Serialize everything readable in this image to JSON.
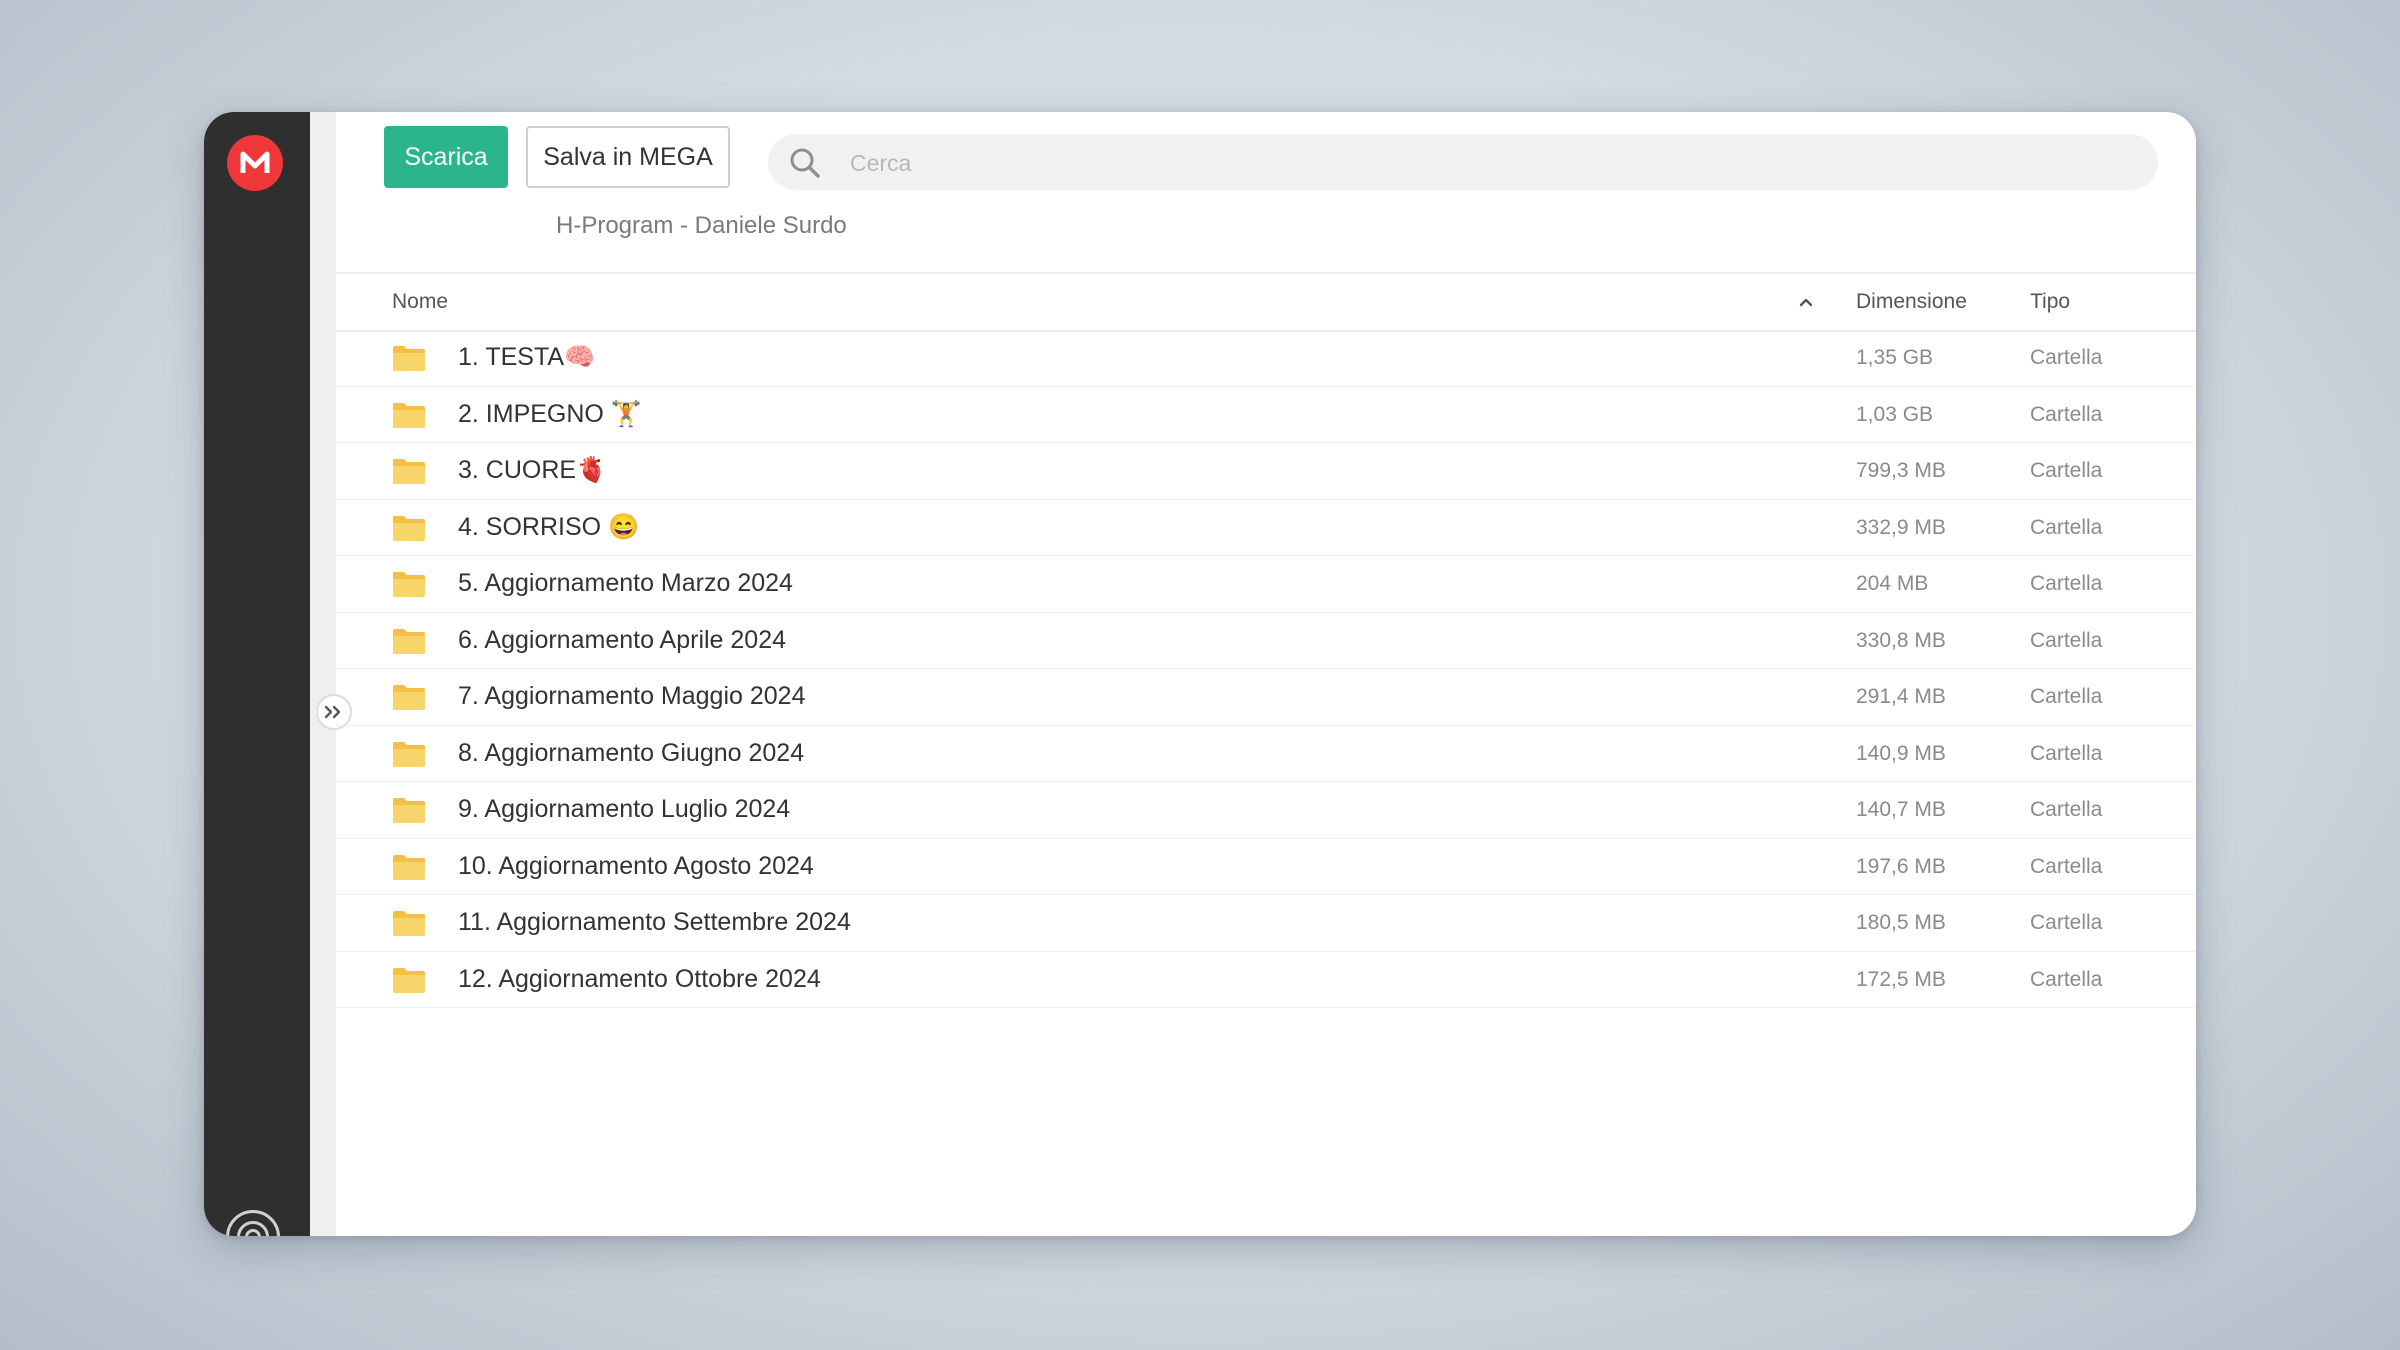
{
  "colors": {
    "accent": "#2bb58a",
    "brand": "#f0373a",
    "sidebar": "#2f2f2f",
    "folder": "#f5c84b"
  },
  "sidebar": {
    "logo_icon": "mega-logo-icon",
    "logo_letter": "M",
    "bottom_icon": "transfers-icon"
  },
  "toolbar": {
    "download_label": "Scarica",
    "save_label": "Salva in MEGA"
  },
  "search": {
    "placeholder": "Cerca",
    "icon": "search-icon"
  },
  "breadcrumb": "H-Program - Daniele Surdo",
  "table": {
    "columns": {
      "name": "Nome",
      "size": "Dimensione",
      "type": "Tipo"
    },
    "sort_icon": "chevron-up-icon",
    "rows": [
      {
        "name": "1. TESTA🧠",
        "size": "1,35 GB",
        "type": "Cartella"
      },
      {
        "name": "2. IMPEGNO 🏋",
        "size": "1,03 GB",
        "type": "Cartella"
      },
      {
        "name": "3. CUORE🫀",
        "size": "799,3 MB",
        "type": "Cartella"
      },
      {
        "name": "4. SORRISO 😄",
        "size": "332,9 MB",
        "type": "Cartella"
      },
      {
        "name": "5. Aggiornamento Marzo 2024",
        "size": "204 MB",
        "type": "Cartella"
      },
      {
        "name": "6. Aggiornamento Aprile 2024",
        "size": "330,8 MB",
        "type": "Cartella"
      },
      {
        "name": "7. Aggiornamento Maggio 2024",
        "size": "291,4 MB",
        "type": "Cartella"
      },
      {
        "name": "8. Aggiornamento Giugno 2024",
        "size": "140,9 MB",
        "type": "Cartella"
      },
      {
        "name": "9. Aggiornamento Luglio 2024",
        "size": "140,7 MB",
        "type": "Cartella"
      },
      {
        "name": "10. Aggiornamento Agosto 2024",
        "size": "197,6 MB",
        "type": "Cartella"
      },
      {
        "name": "11. Aggiornamento Settembre 2024",
        "size": "180,5 MB",
        "type": "Cartella"
      },
      {
        "name": "12. Aggiornamento Ottobre 2024",
        "size": "172,5 MB",
        "type": "Cartella"
      }
    ]
  }
}
